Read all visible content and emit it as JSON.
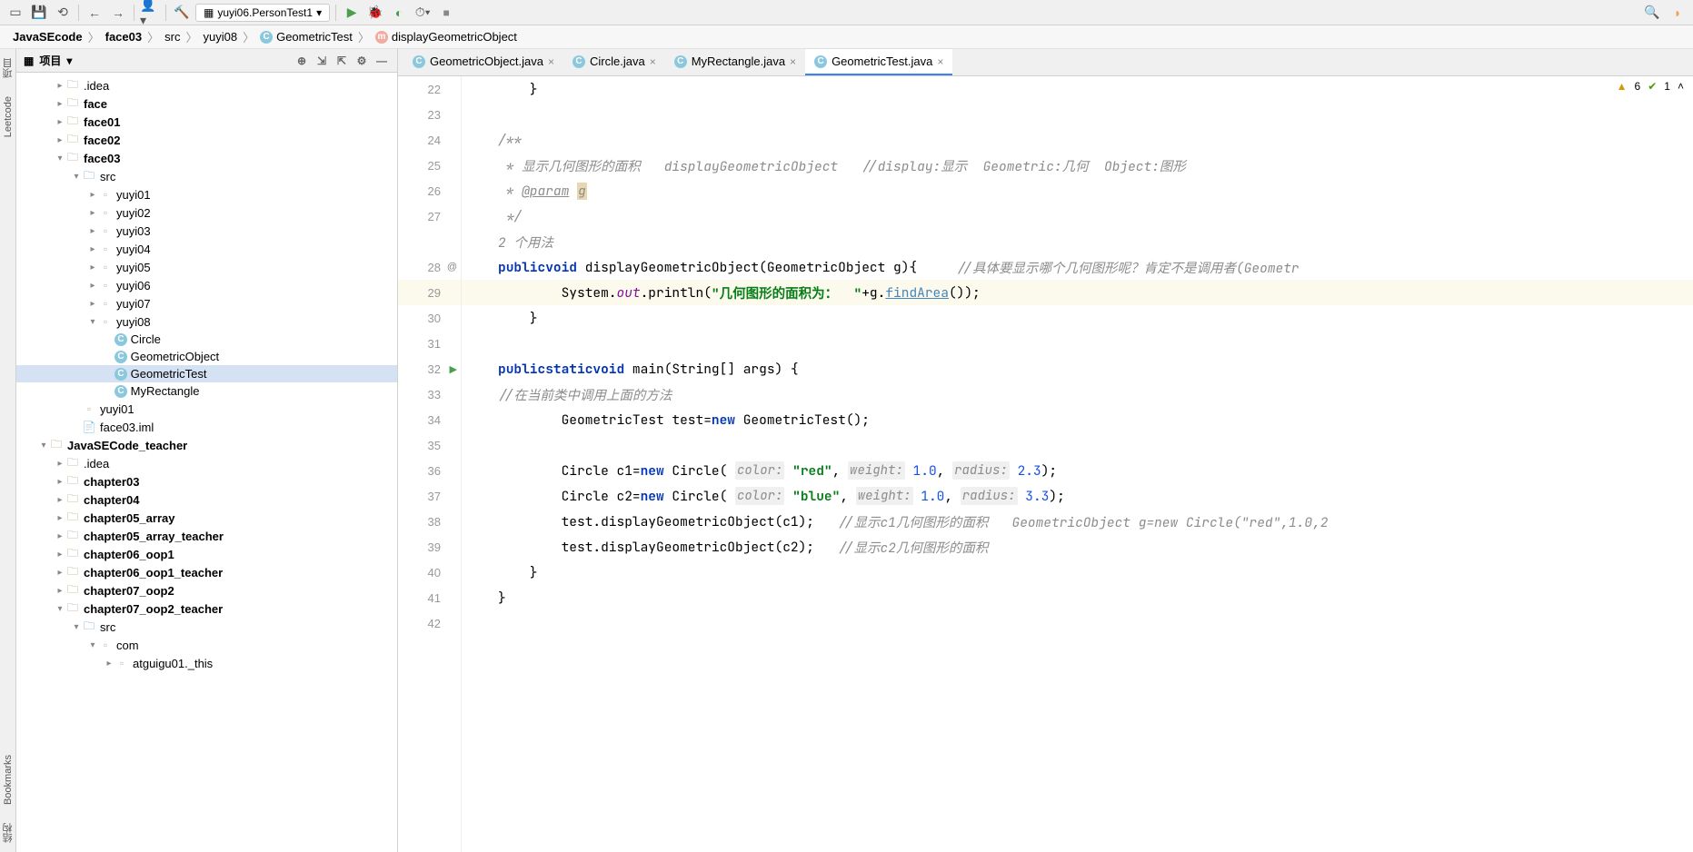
{
  "toolbar": {
    "runConfig": "yuyi06.PersonTest1"
  },
  "breadcrumb": [
    "JavaSEcode",
    "face03",
    "src",
    "yuyi08",
    "GeometricTest",
    "displayGeometricObject"
  ],
  "sidebar": {
    "tabs": [
      "项目",
      "Leetcode",
      "Bookmarks",
      "结构"
    ]
  },
  "panel": {
    "title": "项目"
  },
  "tree": {
    "items": [
      {
        "indent": 2,
        "arrow": "▸",
        "kind": "folder",
        "label": ".idea"
      },
      {
        "indent": 2,
        "arrow": "▸",
        "kind": "folder",
        "label": "face",
        "bold": true
      },
      {
        "indent": 2,
        "arrow": "▸",
        "kind": "folder",
        "label": "face01",
        "bold": true
      },
      {
        "indent": 2,
        "arrow": "▸",
        "kind": "folder",
        "label": "face02",
        "bold": true
      },
      {
        "indent": 2,
        "arrow": "▾",
        "kind": "folder",
        "label": "face03",
        "bold": true
      },
      {
        "indent": 3,
        "arrow": "▾",
        "kind": "srcfolder",
        "label": "src"
      },
      {
        "indent": 4,
        "arrow": "▸",
        "kind": "pkg",
        "label": "yuyi01"
      },
      {
        "indent": 4,
        "arrow": "▸",
        "kind": "pkg",
        "label": "yuyi02"
      },
      {
        "indent": 4,
        "arrow": "▸",
        "kind": "pkg",
        "label": "yuyi03"
      },
      {
        "indent": 4,
        "arrow": "▸",
        "kind": "pkg",
        "label": "yuyi04"
      },
      {
        "indent": 4,
        "arrow": "▸",
        "kind": "pkg",
        "label": "yuyi05"
      },
      {
        "indent": 4,
        "arrow": "▸",
        "kind": "pkg",
        "label": "yuyi06"
      },
      {
        "indent": 4,
        "arrow": "▸",
        "kind": "pkg",
        "label": "yuyi07"
      },
      {
        "indent": 4,
        "arrow": "▾",
        "kind": "pkg",
        "label": "yuyi08"
      },
      {
        "indent": 5,
        "arrow": "",
        "kind": "class",
        "label": "Circle"
      },
      {
        "indent": 5,
        "arrow": "",
        "kind": "class",
        "label": "GeometricObject"
      },
      {
        "indent": 5,
        "arrow": "",
        "kind": "class",
        "label": "GeometricTest",
        "selected": true
      },
      {
        "indent": 5,
        "arrow": "",
        "kind": "class",
        "label": "MyRectangle"
      },
      {
        "indent": 3,
        "arrow": "",
        "kind": "pkg",
        "label": "yuyi01"
      },
      {
        "indent": 3,
        "arrow": "",
        "kind": "file",
        "label": "face03.iml"
      },
      {
        "indent": 1,
        "arrow": "▾",
        "kind": "folder",
        "label": "JavaSECode_teacher",
        "bold": true
      },
      {
        "indent": 2,
        "arrow": "▸",
        "kind": "folder",
        "label": ".idea"
      },
      {
        "indent": 2,
        "arrow": "▸",
        "kind": "folder",
        "label": "chapter03",
        "bold": true
      },
      {
        "indent": 2,
        "arrow": "▸",
        "kind": "folder",
        "label": "chapter04",
        "bold": true
      },
      {
        "indent": 2,
        "arrow": "▸",
        "kind": "folder",
        "label": "chapter05_array",
        "bold": true
      },
      {
        "indent": 2,
        "arrow": "▸",
        "kind": "folder",
        "label": "chapter05_array_teacher",
        "bold": true
      },
      {
        "indent": 2,
        "arrow": "▸",
        "kind": "folder",
        "label": "chapter06_oop1",
        "bold": true
      },
      {
        "indent": 2,
        "arrow": "▸",
        "kind": "folder",
        "label": "chapter06_oop1_teacher",
        "bold": true
      },
      {
        "indent": 2,
        "arrow": "▸",
        "kind": "folder",
        "label": "chapter07_oop2",
        "bold": true
      },
      {
        "indent": 2,
        "arrow": "▾",
        "kind": "folder",
        "label": "chapter07_oop2_teacher",
        "bold": true
      },
      {
        "indent": 3,
        "arrow": "▾",
        "kind": "srcfolder",
        "label": "src"
      },
      {
        "indent": 4,
        "arrow": "▾",
        "kind": "pkg",
        "label": "com"
      },
      {
        "indent": 5,
        "arrow": "▸",
        "kind": "pkg",
        "label": "atguigu01._this"
      }
    ]
  },
  "tabs": [
    {
      "label": "GeometricObject.java"
    },
    {
      "label": "Circle.java"
    },
    {
      "label": "MyRectangle.java"
    },
    {
      "label": "GeometricTest.java",
      "active": true
    }
  ],
  "info": {
    "warnings": "6",
    "checks": "1"
  },
  "lines": [
    22,
    23,
    24,
    25,
    26,
    27,
    28,
    29,
    30,
    31,
    32,
    33,
    34,
    35,
    36,
    37,
    38,
    39,
    40,
    41,
    42
  ],
  "code": {
    "usage": "2 个用法",
    "d1": "/**",
    "d2": " * 显示几何图形的面积   displayGeometricObject   //display:显示  Geometric:几何  Object:图形",
    "d3a": " * ",
    "d3b": "@param",
    "d3c": " g",
    "d4": " */",
    "sig1": "public",
    "sig2": "void",
    "sig3": "displayGeometricObject(GeometricObject g){",
    "sigc": "//具体要显示哪个几何图形呢？肯定不是调用者(Geometr",
    "l29a": "System.",
    "l29b": "out",
    "l29c": ".println(",
    "l29d": "\"几何图形的面积为：  \"",
    "l29e": "+g.",
    "l29f": "findArea",
    "l29g": "());",
    "mn1": "public",
    "mn2": "static",
    "mn3": "void",
    "mn4": "main(String[] args) {",
    "c33": "//在当前类中调用上面的方法",
    "l34": "GeometricTest test=",
    "l34n": "new ",
    "l34t": "GeometricTest();",
    "l36a": "Circle c1=",
    "l36n": "new ",
    "l36b": "Circle( ",
    "p1": "color:",
    "l36c": " \"red\"",
    "l36d": ", ",
    "p2": "weight:",
    "l36e": " 1.0",
    "l36f": ", ",
    "p3": "radius:",
    "l36g": " 2.3",
    "l36h": ");",
    "l37a": "Circle c2=",
    "l37n": "new ",
    "l37b": "Circle( ",
    "l37c": " \"blue\"",
    "l37e": " 1.0",
    "l37g": " 3.3",
    "l37h": ");",
    "l38": "test.displayGeometricObject(c1);   ",
    "c38": "//显示c1几何图形的面积   GeometricObject g=new Circle(\"red\",1.0,2",
    "l39": "test.displayGeometricObject(c2);   ",
    "c39": "//显示c2几何图形的面积"
  }
}
